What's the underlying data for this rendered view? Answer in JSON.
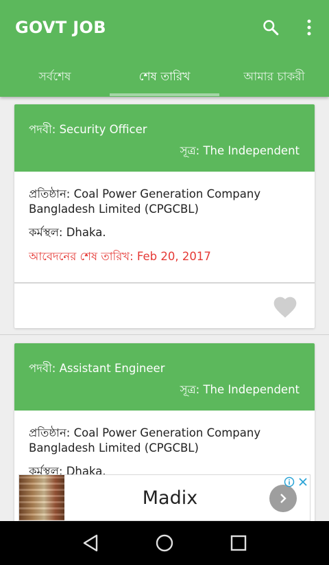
{
  "app": {
    "title": "GOVT JOB"
  },
  "tabs": [
    {
      "label": "সর্বশেষ"
    },
    {
      "label": "শেষ তারিখ"
    },
    {
      "label": "আমার চাকরী"
    }
  ],
  "jobs": [
    {
      "post": "পদবী: Security Officer",
      "source": "সূত্র: The Independent",
      "org": "প্রতিষ্ঠান: Coal Power Generation Company Bangladesh Limited (CPGCBL)",
      "location": "কর্মস্থল: Dhaka.",
      "deadline": "আবেদনের শেষ তারিখ: Feb 20, 2017"
    },
    {
      "post": "পদবী: Assistant Engineer",
      "source": "সূত্র: The Independent",
      "org": "প্রতিষ্ঠান: Coal Power Generation Company Bangladesh Limited (CPGCBL)",
      "location": "কর্মস্থল: Dhaka."
    }
  ],
  "ad": {
    "title": "Madix"
  },
  "icons": {
    "search": "search-icon",
    "more": "more-vert-icon",
    "favorite": "heart-icon",
    "ad_next": "chevron-right-icon",
    "ad_info": "info-icon",
    "ad_close": "close-icon",
    "nav_back": "back-triangle-icon",
    "nav_home": "home-circle-icon",
    "nav_recents": "recents-square-icon"
  },
  "colors": {
    "primary": "#5cb85c",
    "deadline": "#e53935",
    "fav_inactive": "#cfcfcf"
  }
}
